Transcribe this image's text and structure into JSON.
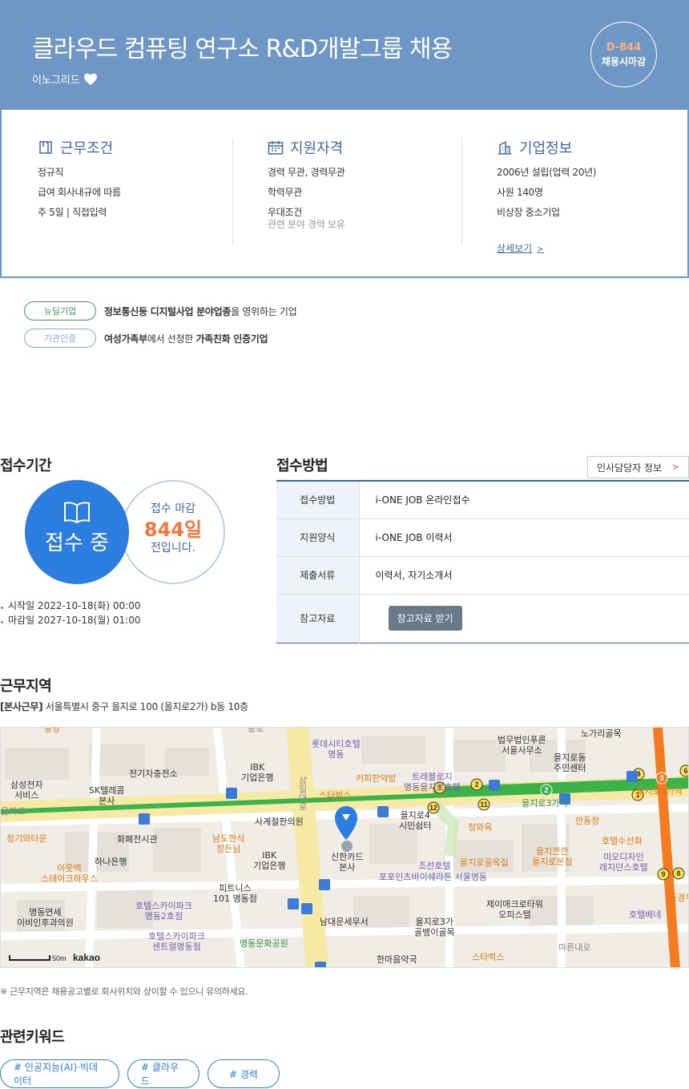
{
  "header": {
    "title": "클라우드 컴퓨팅 연구소 R&D개발그룹 채용",
    "company": "이노그리드",
    "dday": "D-844",
    "dday_label": "채용시마감"
  },
  "info": {
    "work": {
      "title": "근무조건",
      "items": [
        "정규직",
        "급여 회사내규에 따름",
        "주 5일 | 직접입력"
      ]
    },
    "qual": {
      "title": "지원자격",
      "items": [
        "경력 무관, 경력무관",
        "학력무관",
        "우대조건"
      ],
      "sub": "관련 분야 경력 보유"
    },
    "company": {
      "title": "기업정보",
      "items": [
        "2006년 설립(업력 20년)",
        "사원 140명",
        "비상장 중소기업"
      ],
      "more": "상세보기"
    }
  },
  "badges": [
    {
      "pill": "뉴딜기업",
      "text_bold_a": "정보통신등 디지털사업 분야업종",
      "text_rest": "을 영위하는 기업"
    },
    {
      "pill": "기관인증",
      "text_bold_a": "여성가족부",
      "text_mid": "에서 선정한 ",
      "text_bold_b": "가족친화 인증기업"
    }
  ],
  "period": {
    "title": "접수기간",
    "status": "접수 중",
    "deadline_l1": "접수 마감",
    "deadline_days": "844일",
    "deadline_l3": "전입니다.",
    "start": "시작일 2022-10-18(화) 00:00",
    "end": "마감일 2027-10-18(월) 01:00"
  },
  "method": {
    "title": "접수방법",
    "hr_button": "인사담당자 정보",
    "rows": [
      {
        "label": "접수방법",
        "value": "i-ONE JOB 온라인접수"
      },
      {
        "label": "지원양식",
        "value": "i-ONE JOB 이력서"
      },
      {
        "label": "제출서류",
        "value": "이력서, 자기소개서"
      },
      {
        "label": "참고자료",
        "button": "참고자료 받기"
      }
    ]
  },
  "location": {
    "title": "근무지역",
    "addr_tag": "[본사근무]",
    "addr": " 서울특별시 중구 을지로 100 (을지로2가) b동 10층",
    "notice": "※ 근무지역은 채용공고별로 회사위치와 상이할 수 있으니 유의하세요.",
    "map": {
      "scale": "50m",
      "brand": "kakao",
      "labels": [
        "롯데시티호텔 명동",
        "법무법인푸른 서울사무소",
        "노가리골목",
        "을지로동 주민센터",
        "IBK 기업은행",
        "전기차충전소",
        "삼성전자 서비스",
        "SK텔레콤 본사",
        "커피한약방",
        "트레블로지 명동을지로호텔",
        "스타벅스",
        "을지로3가역",
        "을지로입구",
        "청와옥",
        "사계절한의원",
        "남도한식 정든님",
        "IBK 기업은행",
        "을지로4 시민쉼터",
        "안동장",
        "호텔수선화",
        "정기와타운",
        "화폐전시관",
        "하나은행",
        "신한카드 본사",
        "조선호텔",
        "을지로골목집",
        "을지깐깐 을지로본점",
        "미오디자인 레지던스호텔",
        "아웃백 스테이크하우스",
        "포포인츠바이쉐라톤 서울명동",
        "동경우",
        "피트니스 101 명동점",
        "호텔스카이파크 명동2호점",
        "제이매크로타워 오피스텔",
        "호텔베네",
        "명동연세 이비인후과의원",
        "남대문세무서",
        "을지로3가 골뱅이골목",
        "호텔스카이파크 센트럴명동점",
        "명동문화공원",
        "한마음약국",
        "스타벅스",
        "마른내로",
        "을지로",
        "삼일대로",
        "종로",
        "중앙"
      ]
    }
  },
  "keywords": {
    "title": "관련키워드",
    "items": [
      "# 인공지능(AI)·빅데이터",
      "# 클라우드",
      "# 경력"
    ]
  },
  "colors": {
    "header_bg": "#6f97c6",
    "accent_blue": "#2c7de0",
    "accent_orange": "#f5763a",
    "green": "#3ea05f"
  }
}
